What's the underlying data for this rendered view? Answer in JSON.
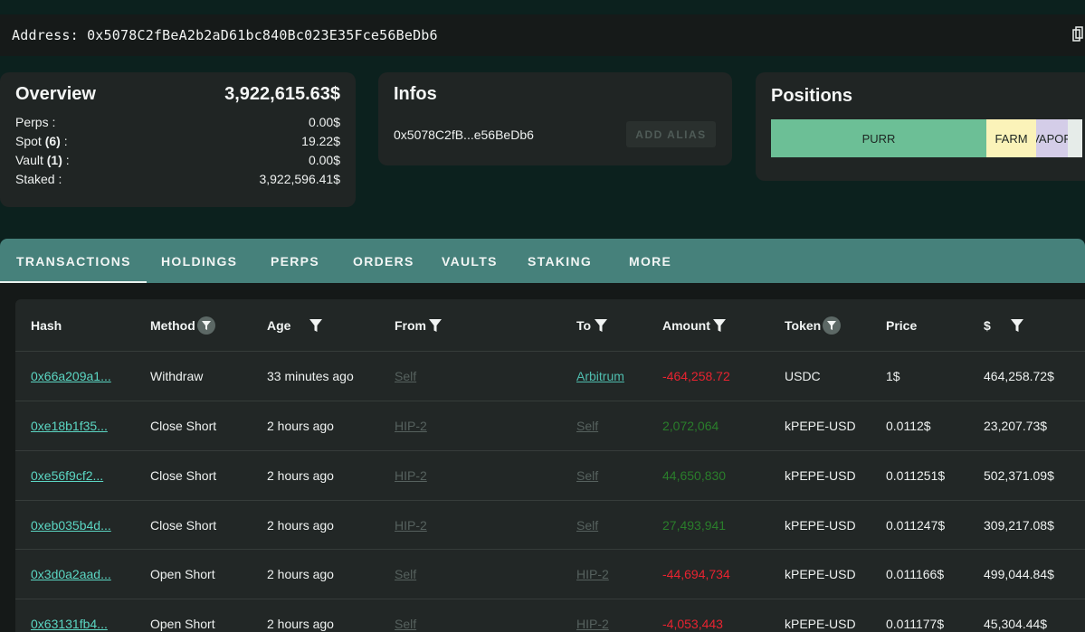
{
  "address_bar": {
    "label": "Address: 0x5078C2fBeA2b2aD61bc840Bc023E35Fce56BeDb6"
  },
  "overview": {
    "title": "Overview",
    "total": "3,922,615.63$",
    "rows": [
      {
        "label": "Perps :",
        "count": "",
        "suffix": "",
        "value": "0.00$"
      },
      {
        "label": "Spot ",
        "count": "(6)",
        "suffix": " :",
        "value": "19.22$"
      },
      {
        "label": "Vault ",
        "count": "(1)",
        "suffix": " :",
        "value": "0.00$"
      },
      {
        "label": "Staked :",
        "count": "",
        "suffix": "",
        "value": "3,922,596.41$"
      }
    ]
  },
  "infos": {
    "title": "Infos",
    "short_address": "0x5078C2fB...e56BeDb6",
    "add_alias_label": "ADD ALIAS"
  },
  "positions": {
    "title": "Positions",
    "segments": [
      {
        "label": "PURR",
        "color": "#6cbf96"
      },
      {
        "label": "FARM",
        "color": "#fbf3b9"
      },
      {
        "label": "VAPOR",
        "color": "#d4cde8"
      }
    ]
  },
  "tabs": [
    {
      "label": "TRANSACTIONS",
      "active": true
    },
    {
      "label": "HOLDINGS"
    },
    {
      "label": "PERPS"
    },
    {
      "label": "ORDERS"
    },
    {
      "label": "VAULTS"
    },
    {
      "label": "STAKING"
    },
    {
      "label": "MORE"
    }
  ],
  "table": {
    "headers": {
      "hash": "Hash",
      "method": "Method",
      "age": "Age",
      "from": "From",
      "to": "To",
      "amount": "Amount",
      "token": "Token",
      "price": "Price",
      "usd": "$"
    },
    "rows": [
      {
        "hash": "0x66a209a1...",
        "method": "Withdraw",
        "age": "33 minutes ago",
        "from": "Self",
        "to": "Arbitrum",
        "amount": "-464,258.72",
        "token": "USDC",
        "price": "1$",
        "usd": "464,258.72$"
      },
      {
        "hash": "0xe18b1f35...",
        "method": "Close Short",
        "age": "2 hours ago",
        "from": "HIP-2",
        "to": "Self",
        "amount": "2,072,064",
        "token": "kPEPE-USD",
        "price": "0.0112$",
        "usd": "23,207.73$"
      },
      {
        "hash": "0xe56f9cf2...",
        "method": "Close Short",
        "age": "2 hours ago",
        "from": "HIP-2",
        "to": "Self",
        "amount": "44,650,830",
        "token": "kPEPE-USD",
        "price": "0.011251$",
        "usd": "502,371.09$"
      },
      {
        "hash": "0xeb035b4d...",
        "method": "Close Short",
        "age": "2 hours ago",
        "from": "HIP-2",
        "to": "Self",
        "amount": "27,493,941",
        "token": "kPEPE-USD",
        "price": "0.011247$",
        "usd": "309,217.08$"
      },
      {
        "hash": "0x3d0a2aad...",
        "method": "Open Short",
        "age": "2 hours ago",
        "from": "Self",
        "to": "HIP-2",
        "amount": "-44,694,734",
        "token": "kPEPE-USD",
        "price": "0.011166$",
        "usd": "499,044.84$"
      },
      {
        "hash": "0x63131fb4...",
        "method": "Open Short",
        "age": "2 hours ago",
        "from": "Self",
        "to": "HIP-2",
        "amount": "-4,053,443",
        "token": "kPEPE-USD",
        "price": "0.011177$",
        "usd": "45,304.44$"
      }
    ]
  },
  "colors": {
    "background": "#0c211e",
    "card": "#202524",
    "tab_bar": "#46817b",
    "link": "#5bd6c3",
    "negative": "#e82330",
    "positive": "#2a7e2b"
  }
}
